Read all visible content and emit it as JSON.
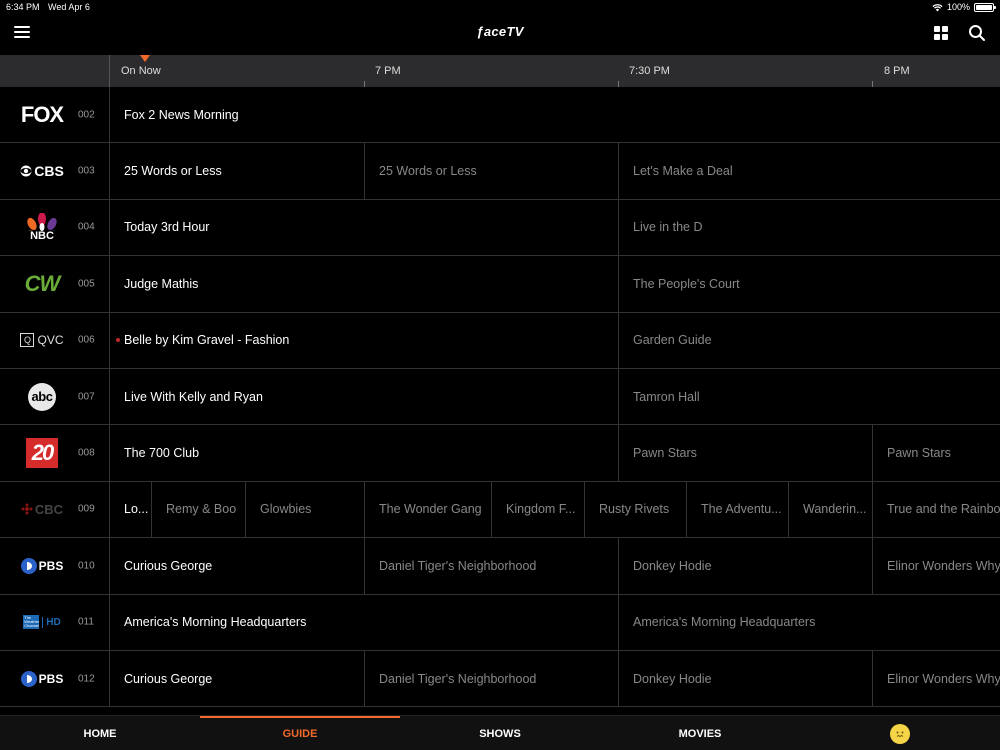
{
  "status_bar": {
    "time": "6:34 PM",
    "date": "Wed Apr 6",
    "battery": "100%",
    "battery_level": 1.0
  },
  "header": {
    "title": "ƒaceTV",
    "menu_icon": "hamburger-menu-icon",
    "grid_icon": "grid-view-icon",
    "search_icon": "search-icon"
  },
  "timeline": {
    "now_label": "On Now",
    "slots": [
      "7 PM",
      "7:30 PM",
      "8 PM"
    ]
  },
  "channels": [
    {
      "number": "002",
      "logo": "FOX",
      "programs": [
        {
          "title": "Fox 2 News Morning",
          "now": true
        }
      ]
    },
    {
      "number": "003",
      "logo": "CBS",
      "programs": [
        {
          "title": "25 Words or Less",
          "now": true
        },
        {
          "title": "25 Words or Less"
        },
        {
          "title": "Let's Make a Deal"
        }
      ]
    },
    {
      "number": "004",
      "logo": "NBC",
      "programs": [
        {
          "title": "Today 3rd Hour",
          "now": true
        },
        {
          "title": "Live in the D"
        }
      ]
    },
    {
      "number": "005",
      "logo": "CW",
      "programs": [
        {
          "title": "Judge Mathis",
          "now": true
        },
        {
          "title": "The People's Court"
        }
      ]
    },
    {
      "number": "006",
      "logo": "QVC",
      "programs": [
        {
          "title": "Belle by Kim Gravel - Fashion",
          "now": true,
          "live": true
        },
        {
          "title": "Garden Guide"
        }
      ]
    },
    {
      "number": "007",
      "logo": "abc",
      "programs": [
        {
          "title": "Live With Kelly and Ryan",
          "now": true
        },
        {
          "title": "Tamron Hall"
        }
      ]
    },
    {
      "number": "008",
      "logo": "20",
      "programs": [
        {
          "title": "The 700 Club",
          "now": true
        },
        {
          "title": "Pawn Stars"
        },
        {
          "title": "Pawn Stars"
        }
      ]
    },
    {
      "number": "009",
      "logo": "CBC",
      "programs": [
        {
          "title": "Lo...",
          "now": true
        },
        {
          "title": "Remy & Boo"
        },
        {
          "title": "Glowbies"
        },
        {
          "title": "The Wonder Gang"
        },
        {
          "title": "Kingdom F..."
        },
        {
          "title": "Rusty Rivets"
        },
        {
          "title": "The Adventu..."
        },
        {
          "title": "Wanderin..."
        },
        {
          "title": "True and the Rainbow"
        }
      ]
    },
    {
      "number": "010",
      "logo": "PBS",
      "programs": [
        {
          "title": "Curious George",
          "now": true
        },
        {
          "title": "Daniel Tiger's Neighborhood"
        },
        {
          "title": "Donkey Hodie"
        },
        {
          "title": "Elinor Wonders Why"
        }
      ]
    },
    {
      "number": "011",
      "logo": "The Weather Channel HD",
      "programs": [
        {
          "title": "America's Morning Headquarters",
          "now": true
        },
        {
          "title": "America's Morning Headquarters"
        }
      ]
    },
    {
      "number": "012",
      "logo": "PBS",
      "programs": [
        {
          "title": "Curious George",
          "now": true
        },
        {
          "title": "Daniel Tiger's Neighborhood"
        },
        {
          "title": "Donkey Hodie"
        },
        {
          "title": "Elinor Wonders Why"
        }
      ]
    }
  ],
  "tabs": [
    {
      "label": "HOME"
    },
    {
      "label": "GUIDE",
      "active": true
    },
    {
      "label": "SHOWS"
    },
    {
      "label": "MOVIES"
    },
    {
      "label": "",
      "icon": "profile-avatar-icon"
    }
  ],
  "colors": {
    "accent": "#f26a2a",
    "live_dot": "#c0272d",
    "background": "#000000",
    "timeline_bg": "#2c2c2e"
  }
}
